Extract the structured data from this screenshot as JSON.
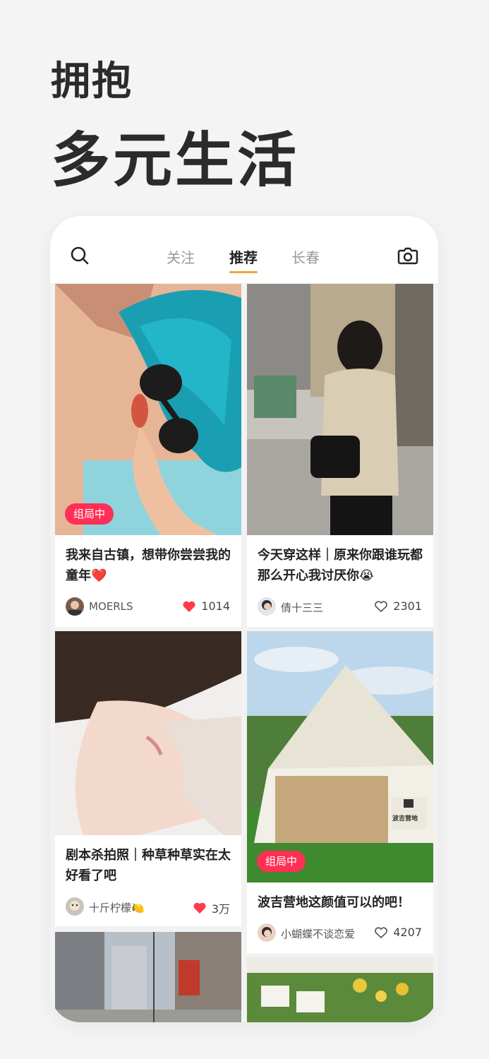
{
  "hero": {
    "line1": "拥抱",
    "line2": "多元生活"
  },
  "nav": {
    "tabs": [
      {
        "label": "关注",
        "active": false
      },
      {
        "label": "推荐",
        "active": true
      },
      {
        "label": "长春",
        "active": false
      }
    ],
    "search_icon": "search-icon",
    "camera_icon": "camera-icon",
    "accent_color": "#f2a53a"
  },
  "feed": {
    "posts": [
      {
        "title": "我来自古镇，想带你尝尝我的童年❤️",
        "badge": "组局中",
        "author": "MOERLS",
        "likes": "1014",
        "liked": true
      },
      {
        "title": "今天穿这样｜原来你跟谁玩都那么开心我讨厌你😭",
        "badge": "",
        "author": "倩十三三",
        "likes": "2301",
        "liked": false
      },
      {
        "title": "剧本杀拍照｜种草种草实在太好看了吧",
        "badge": "",
        "author": "十斤柠檬🍋",
        "likes": "3万",
        "liked": true
      },
      {
        "title": "波吉营地这颜值可以的吧！",
        "badge": "组局中",
        "author": "小蝴蝶不谈恋爱",
        "likes": "4207",
        "liked": false
      }
    ],
    "tent_sign": "波吉营地",
    "badge_color": "#ff2f56",
    "like_color": "#ff3b4f"
  }
}
